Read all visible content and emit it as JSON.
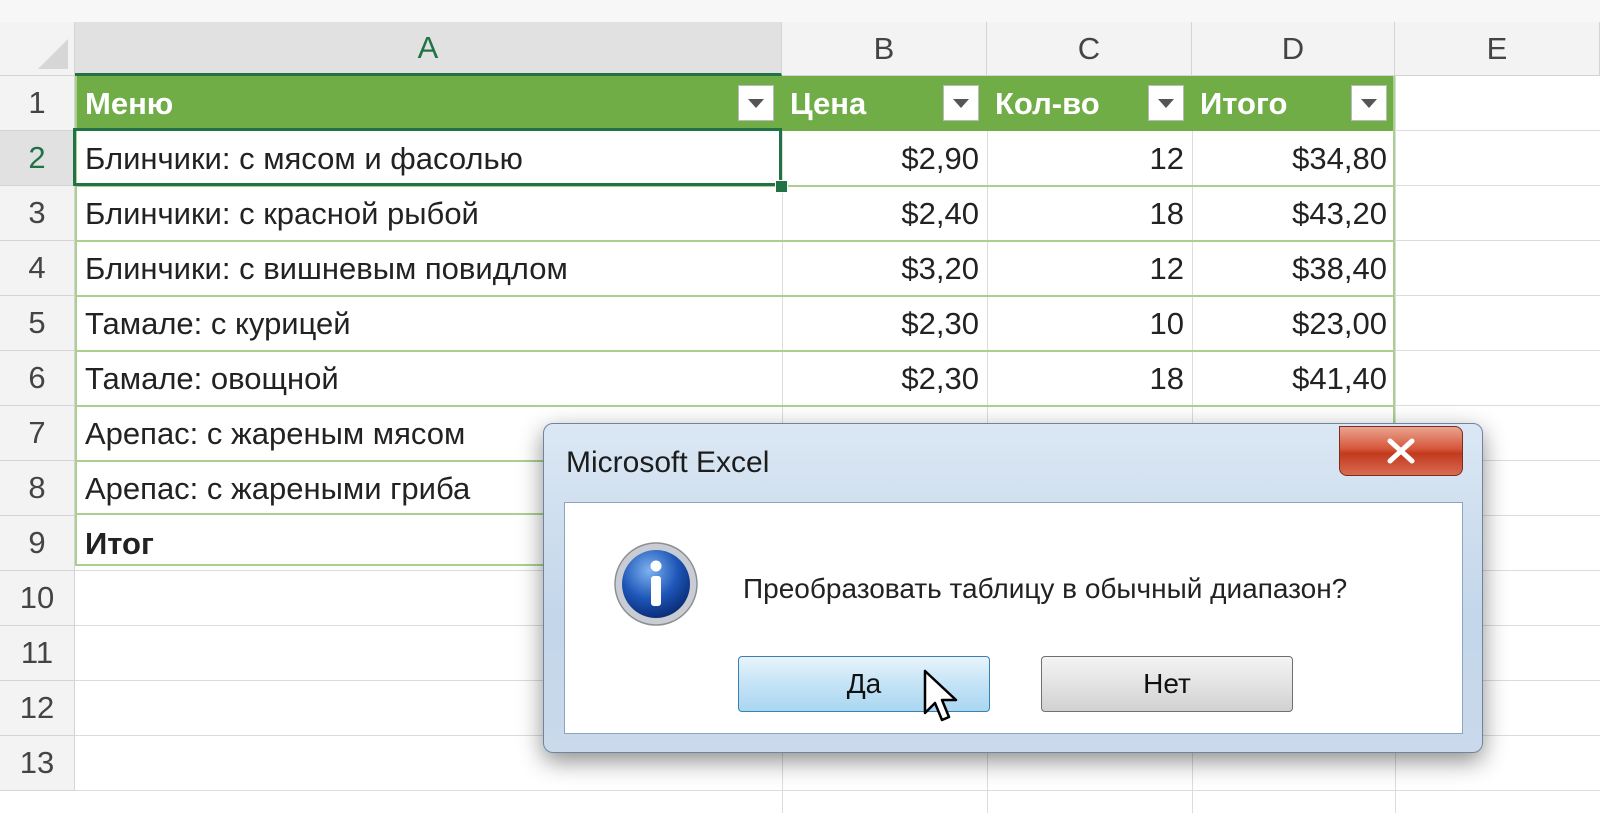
{
  "columns": [
    "A",
    "B",
    "C",
    "D",
    "E"
  ],
  "row_numbers": [
    "1",
    "2",
    "3",
    "4",
    "5",
    "6",
    "7",
    "8",
    "9",
    "10",
    "11",
    "12",
    "13"
  ],
  "table": {
    "headers": [
      "Меню",
      "Цена",
      "Кол-во",
      "Итого"
    ],
    "rows": [
      [
        "Блинчики: с мясом и фасолью",
        "$2,90",
        "12",
        "$34,80"
      ],
      [
        "Блинчики: с красной рыбой",
        "$2,40",
        "18",
        "$43,20"
      ],
      [
        "Блинчики: с вишневым повидлом",
        "$3,20",
        "12",
        "$38,40"
      ],
      [
        "Тамале: с курицей",
        "$2,30",
        "10",
        "$23,00"
      ],
      [
        "Тамале: овощной",
        "$2,30",
        "18",
        "$41,40"
      ],
      [
        "Арепас: с жареным мясом",
        "",
        "",
        ""
      ],
      [
        "Арепас: с жареными гриба",
        "",
        "",
        ""
      ]
    ],
    "total_label": "Итог"
  },
  "dialog": {
    "title": "Microsoft Excel",
    "message": "Преобразовать таблицу в обычный диапазон?",
    "yes_label": "Да",
    "no_label": "Нет",
    "icon": "info-icon"
  },
  "colors": {
    "table_header": "#70ad47",
    "table_line": "#a9d08e",
    "selection": "#217346",
    "close_button": "#c9452a"
  }
}
